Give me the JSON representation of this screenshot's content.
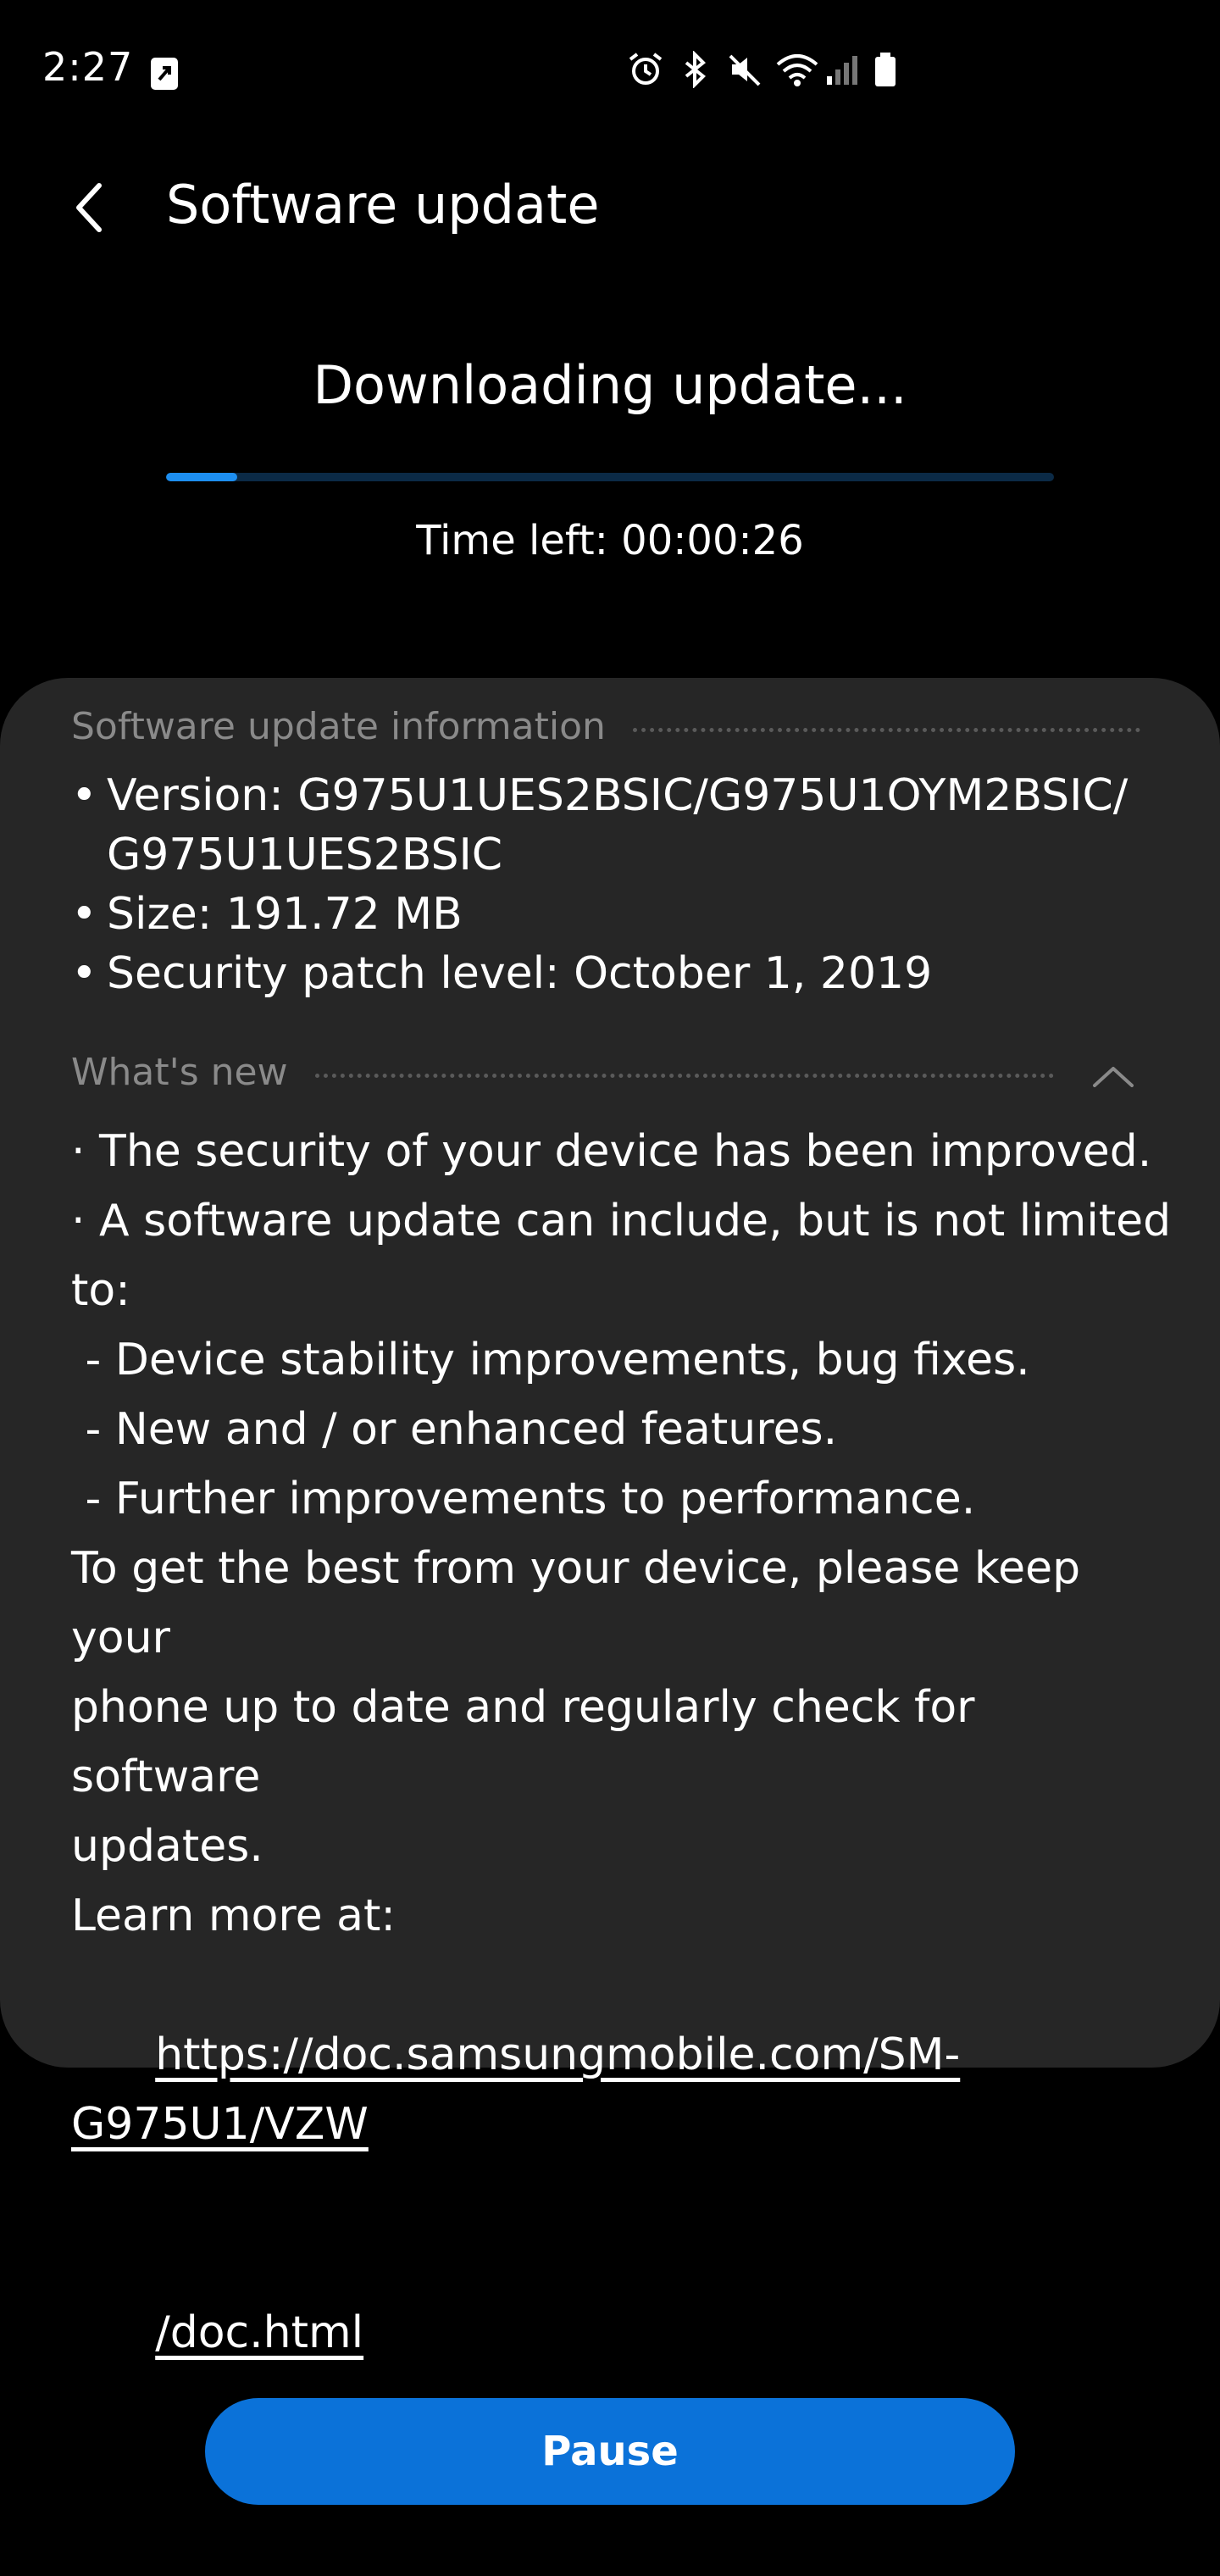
{
  "status_bar": {
    "time": "2:27",
    "icons": [
      "media-icon",
      "alarm-icon",
      "bluetooth-icon",
      "mute-icon",
      "wifi-icon",
      "signal-icon",
      "battery-icon"
    ]
  },
  "header": {
    "title": "Software update"
  },
  "download": {
    "heading": "Downloading update...",
    "progress_fraction": 0.08,
    "time_left": "Time left: 00:00:26"
  },
  "info": {
    "section_title": "Software update information",
    "items": [
      "Version: G975U1UES2BSIC/G975U1OYM2BSIC/\nG975U1UES2BSIC",
      "Size: 191.72 MB",
      "Security patch level: October 1, 2019"
    ],
    "bullet": "•"
  },
  "whats_new": {
    "title": "What's new",
    "lines": [
      "· The security of your device has been improved.",
      "",
      "· A software update can include, but is not limited to:",
      " - Device stability improvements, bug fixes.",
      " - New and / or enhanced features.",
      " - Further improvements to performance.",
      "To get the best from your device, please keep your",
      "phone up to date and regularly check for software",
      "updates.",
      "",
      "Learn more at:"
    ],
    "link_line_1": "https://doc.samsungmobile.com/SM-G975U1/VZW",
    "link_line_2": "/doc.html"
  },
  "actions": {
    "pause_label": "Pause"
  },
  "colors": {
    "accent": "#0b72d9",
    "progress_fill": "#1d8ef0",
    "card_bg": "#262626"
  }
}
